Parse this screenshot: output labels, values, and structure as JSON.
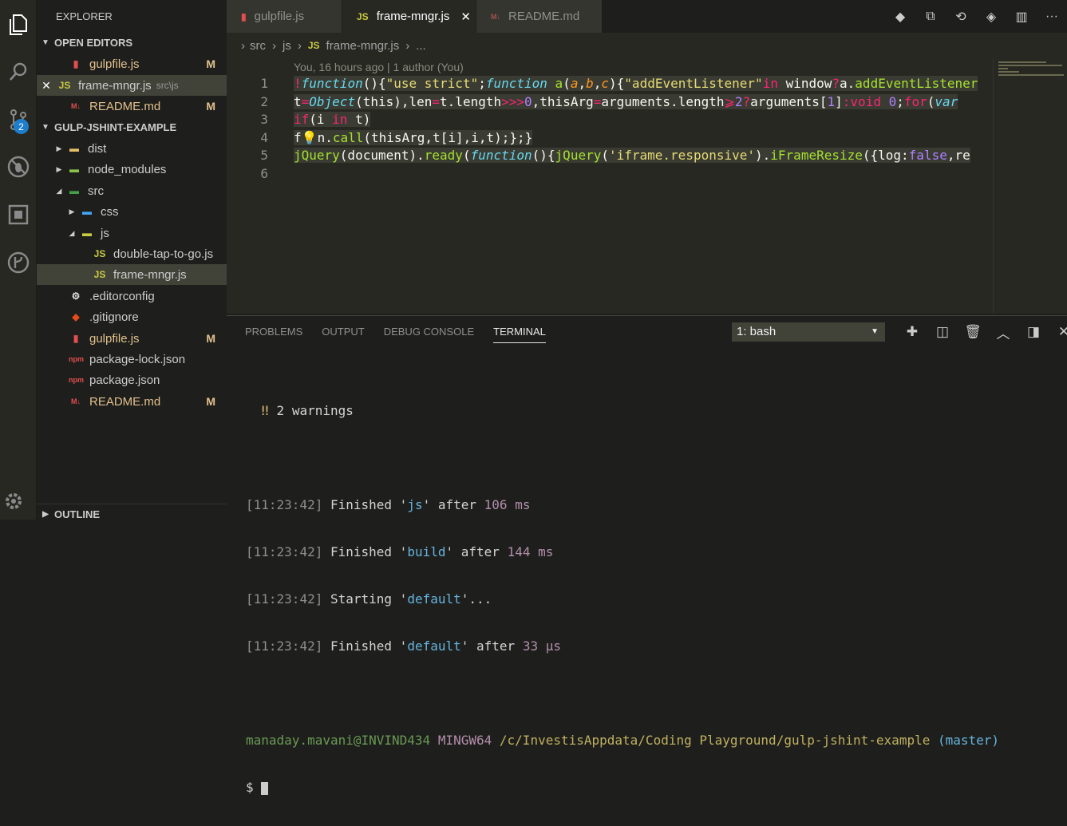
{
  "activity": {
    "icons": [
      "files-icon",
      "search-icon",
      "source-control-icon",
      "extensions-icon",
      "remote-icon",
      "git-graph-icon"
    ],
    "scm_badge": "2",
    "settings_icon": "gear-icon"
  },
  "sidebar": {
    "title": "EXPLORER",
    "open_editors_label": "OPEN EDITORS",
    "open_editors": [
      {
        "label": "gulpfile.js",
        "badge": "M",
        "sub": ""
      },
      {
        "label": "frame-mngr.js",
        "badge": "",
        "sub": "src\\js"
      },
      {
        "label": "README.md",
        "badge": "M",
        "sub": ""
      }
    ],
    "project_label": "GULP-JSHINT-EXAMPLE",
    "tree": [
      {
        "label": "dist",
        "badge": ""
      },
      {
        "label": "node_modules",
        "badge": ""
      },
      {
        "label": "src",
        "badge": ""
      },
      {
        "label": "css",
        "badge": ""
      },
      {
        "label": "js",
        "badge": ""
      },
      {
        "label": "double-tap-to-go.js",
        "badge": ""
      },
      {
        "label": "frame-mngr.js",
        "badge": ""
      },
      {
        "label": ".editorconfig",
        "badge": ""
      },
      {
        "label": ".gitignore",
        "badge": ""
      },
      {
        "label": "gulpfile.js",
        "badge": "M"
      },
      {
        "label": "package-lock.json",
        "badge": ""
      },
      {
        "label": "package.json",
        "badge": ""
      },
      {
        "label": "README.md",
        "badge": "M"
      }
    ],
    "outline_label": "OUTLINE"
  },
  "tabs": [
    {
      "label": "gulpfile.js",
      "icon": "JS"
    },
    {
      "label": "frame-mngr.js",
      "icon": "JS"
    },
    {
      "label": "README.md",
      "icon": "md"
    }
  ],
  "breadcrumb": {
    "a": "src",
    "b": "js",
    "c": "frame-mngr.js",
    "d": "..."
  },
  "editor": {
    "blame": "You, 16 hours ago | 1 author (You)",
    "line_numbers": [
      "1",
      "2",
      "3",
      "4",
      "5",
      "6"
    ]
  },
  "panel": {
    "tabs": [
      "PROBLEMS",
      "OUTPUT",
      "DEBUG CONSOLE",
      "TERMINAL"
    ],
    "terminal_select": "1: bash",
    "warnings": "2 warnings",
    "lines": [
      {
        "time": "11:23:42",
        "verb": "Finished",
        "task": "js",
        "tail": "after",
        "num": "106 ms"
      },
      {
        "time": "11:23:42",
        "verb": "Finished",
        "task": "build",
        "tail": "after",
        "num": "144 ms"
      },
      {
        "time": "11:23:42",
        "verb": "Starting",
        "task": "default",
        "tail": "...",
        "num": ""
      },
      {
        "time": "11:23:42",
        "verb": "Finished",
        "task": "default",
        "tail": "after",
        "num": "33 μs"
      }
    ],
    "prompt_user": "manaday.mavani@INVIND434",
    "prompt_env": "MINGW64",
    "prompt_path": "/c/InvestisAppdata/Coding Playground/gulp-jshint-example",
    "prompt_branch": "(master)",
    "prompt_symbol": "$"
  }
}
